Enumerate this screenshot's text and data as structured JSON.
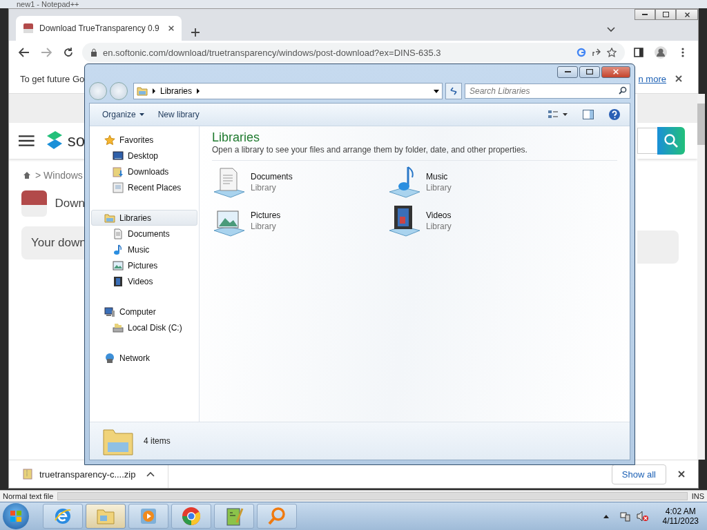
{
  "notepad": {
    "title": "new1 - Notepad++",
    "status_left": "Normal text file",
    "status_right": "INS"
  },
  "browser": {
    "tab_title": "Download TrueTransparency 0.9",
    "address": "en.softonic.com/download/truetransparency/windows/post-download?ex=DINS-635.3",
    "infobar": {
      "message": "To get future Go",
      "link": "n more"
    },
    "page": {
      "logo": "so",
      "breadcrumb": "> Windows",
      "heading": "Down",
      "notice": "Your down"
    },
    "download": {
      "file": "truetransparency-c....zip",
      "button": "Show all"
    }
  },
  "explorer": {
    "address": "Libraries",
    "search_placeholder": "Search Libraries",
    "commands": [
      {
        "label": "Organize",
        "menu": true
      },
      {
        "label": "New library",
        "menu": false
      }
    ],
    "nav": [
      {
        "label": "Favorites",
        "kind": "star",
        "selected": false,
        "children": [
          {
            "label": "Desktop",
            "kind": "desktop",
            "selected": false
          },
          {
            "label": "Downloads",
            "kind": "downloads",
            "selected": false
          },
          {
            "label": "Recent Places",
            "kind": "recent",
            "selected": false
          }
        ]
      },
      {
        "label": "Libraries",
        "kind": "library",
        "selected": true,
        "children": [
          {
            "label": "Documents",
            "kind": "documents",
            "selected": false
          },
          {
            "label": "Music",
            "kind": "music",
            "selected": false
          },
          {
            "label": "Pictures",
            "kind": "pictures",
            "selected": false
          },
          {
            "label": "Videos",
            "kind": "videos",
            "selected": false
          }
        ]
      },
      {
        "label": "Computer",
        "kind": "computer",
        "selected": false,
        "children": [
          {
            "label": "Local Disk (C:)",
            "kind": "disk",
            "selected": false
          }
        ]
      },
      {
        "label": "Network",
        "kind": "network",
        "selected": false
      }
    ],
    "heading": "Libraries",
    "subtitle": "Open a library to see your files and arrange them by folder, date, and other properties.",
    "items": [
      {
        "name": "Documents",
        "type": "Library",
        "kind": "documents"
      },
      {
        "name": "Music",
        "type": "Library",
        "kind": "music"
      },
      {
        "name": "Pictures",
        "type": "Library",
        "kind": "pictures"
      },
      {
        "name": "Videos",
        "type": "Library",
        "kind": "videos"
      }
    ],
    "details": "4 items"
  },
  "taskbar": {
    "apps": [
      {
        "kind": "ie",
        "selected": false
      },
      {
        "kind": "explorer",
        "selected": true
      },
      {
        "kind": "media",
        "selected": false
      },
      {
        "kind": "chrome",
        "selected": false
      },
      {
        "kind": "notepad",
        "selected": false
      },
      {
        "kind": "magnifier",
        "selected": false
      }
    ],
    "time": "4:02 AM",
    "date": "4/11/2023"
  }
}
